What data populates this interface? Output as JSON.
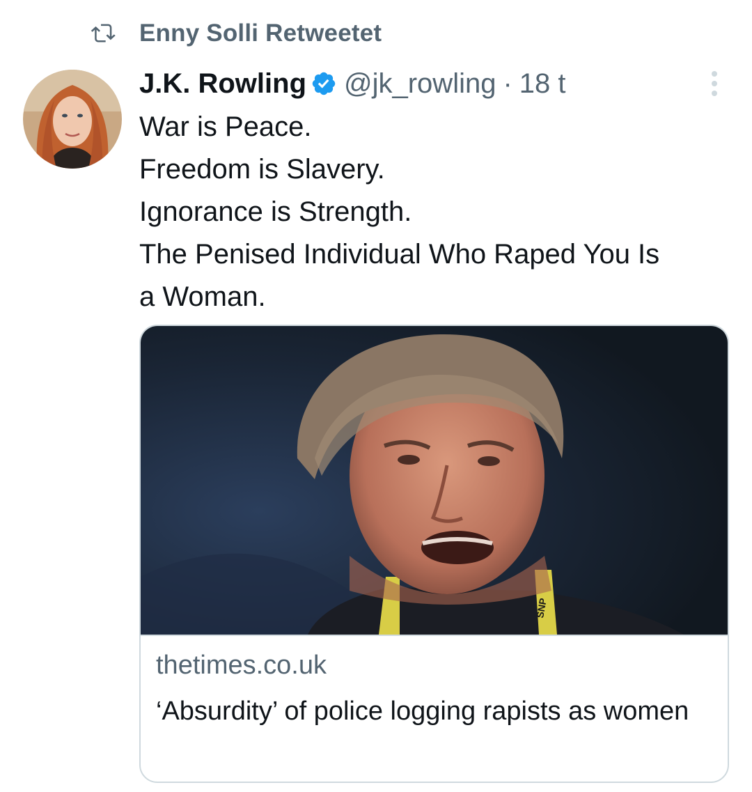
{
  "retweet": {
    "icon": "retweet-icon",
    "label": "Enny Solli Retweetet"
  },
  "tweet": {
    "author_name": "J.K. Rowling",
    "verified": true,
    "handle": "@jk_rowling",
    "separator": "·",
    "time": "18 t",
    "lines": [
      "War is Peace.",
      "Freedom is Slavery.",
      "Ignorance is Strength.",
      "The Penised Individual Who Raped You Is",
      "a Woman."
    ]
  },
  "card": {
    "domain": "thetimes.co.uk",
    "title": "‘Absurdity’ of police logging rapists as women",
    "lanyard_text": "SNP"
  },
  "colors": {
    "text_primary": "#0f1419",
    "text_secondary": "#536471",
    "verified_blue": "#1d9bf0",
    "border": "#cfd9de"
  }
}
